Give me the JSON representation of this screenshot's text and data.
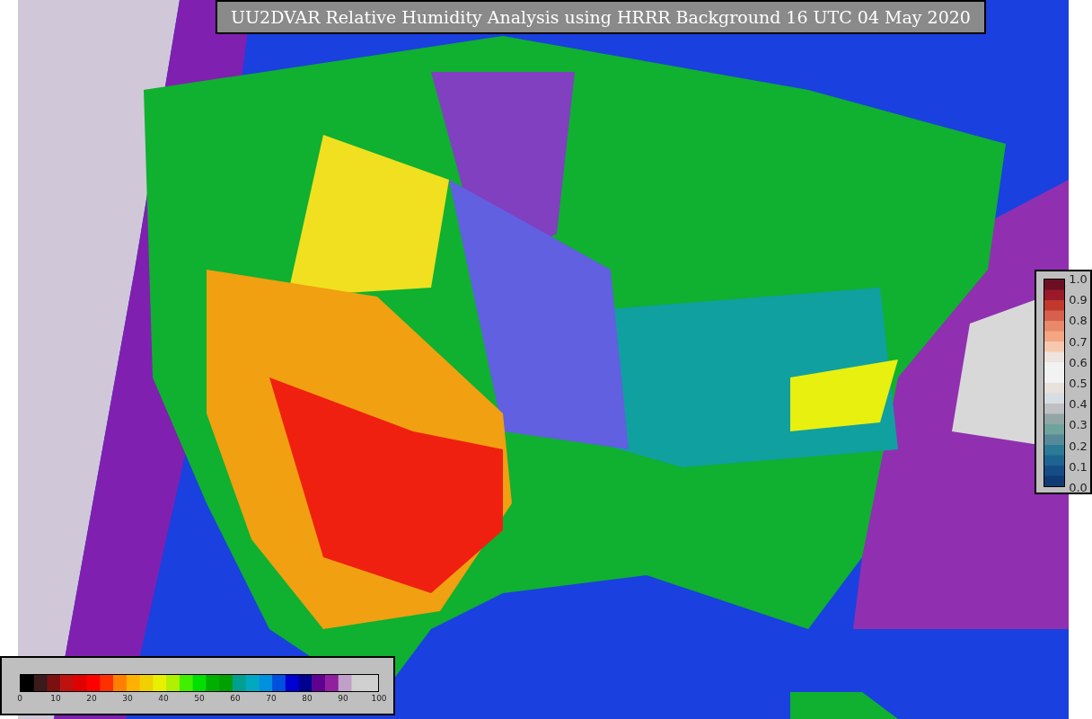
{
  "title": "UU2DVAR Relative Humidity Analysis using HRRR Background 16 UTC 04 May 2020",
  "humidity_colorbar": {
    "ticks": [
      "0",
      "10",
      "20",
      "30",
      "40",
      "50",
      "60",
      "70",
      "80",
      "90",
      "100"
    ]
  },
  "error_colorbar": {
    "ticks": [
      "1.0",
      "0.9",
      "0.8",
      "0.7",
      "0.6",
      "0.5",
      "0.4",
      "0.3",
      "0.2",
      "0.1",
      "0.0"
    ]
  }
}
